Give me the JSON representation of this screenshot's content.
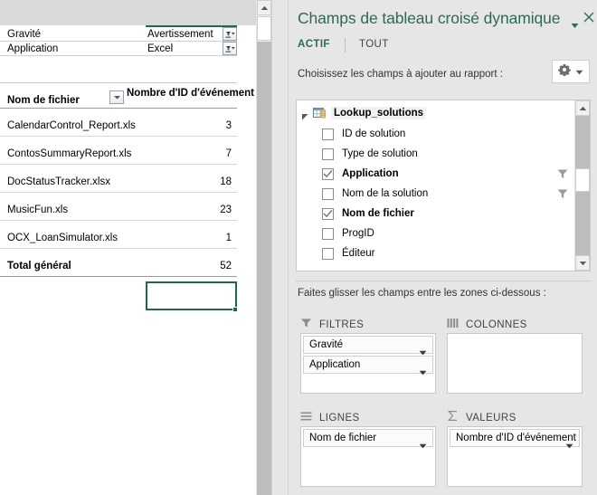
{
  "worksheet": {
    "pivot": {
      "report_filters": [
        {
          "label": "Gravité",
          "value": "Avertissement",
          "filter_icon": "filter-dropdown-icon"
        },
        {
          "label": "Application",
          "value": "Excel",
          "filter_icon": "filter-dropdown-icon"
        }
      ],
      "row_header": "Nom de fichier",
      "row_header_dropdown_icon": "chevron-down-icon",
      "value_header": "Nombre d'ID d'événement",
      "rows": [
        {
          "name": "CalendarControl_Report.xls",
          "value": "3"
        },
        {
          "name": "ContosSummaryReport.xls",
          "value": "7"
        },
        {
          "name": "DocStatusTracker.xlsx",
          "value": "18"
        },
        {
          "name": "MusicFun.xls",
          "value": "23"
        },
        {
          "name": "OCX_LoanSimulator.xls",
          "value": "1"
        }
      ],
      "total_row": {
        "name": "Total général",
        "value": "52"
      },
      "selected_cell_value": "52"
    },
    "scrollbar": {
      "up_arrow_icon": "triangle-up-icon"
    }
  },
  "fields_pane": {
    "title": "Champs de tableau croisé dynamique",
    "title_caret_icon": "chevron-down-icon",
    "close_icon": "close-icon",
    "tabs": [
      {
        "label": "ACTIF",
        "active": true
      },
      {
        "label": "TOUT",
        "active": false
      }
    ],
    "choose_fields_label": "Choisissez les champs à ajouter au rapport :",
    "tools_button": {
      "gear_icon": "gear-icon",
      "caret_icon": "chevron-down-icon"
    },
    "field_list": {
      "table_name": "Lookup_solutions",
      "table_icon": "table-icon",
      "expand_icon": "triangle-collapse-icon",
      "fields": [
        {
          "label": "ID de solution",
          "checked": false,
          "filtered": false
        },
        {
          "label": "Type de solution",
          "checked": false,
          "filtered": false
        },
        {
          "label": "Application",
          "checked": true,
          "filtered": true
        },
        {
          "label": "Nom de la solution",
          "checked": false,
          "filtered": true
        },
        {
          "label": "Nom de fichier",
          "checked": true,
          "filtered": false
        },
        {
          "label": "ProgID",
          "checked": false,
          "filtered": false
        },
        {
          "label": "Éditeur",
          "checked": false,
          "filtered": false
        }
      ],
      "scrollbar": {
        "up_arrow_icon": "triangle-up-icon",
        "down_arrow_icon": "triangle-down-icon"
      }
    },
    "drag_instruction": "Faites glisser les champs entre les zones ci-dessous :",
    "zones": [
      {
        "id": "filters",
        "title": "FILTRES",
        "icon": "funnel-icon",
        "chips": [
          {
            "label": "Gravité",
            "caret_icon": "chevron-down-icon"
          },
          {
            "label": "Application",
            "caret_icon": "chevron-down-icon"
          }
        ]
      },
      {
        "id": "columns",
        "title": "COLONNES",
        "icon": "columns-icon",
        "chips": []
      },
      {
        "id": "rows",
        "title": "LIGNES",
        "icon": "rows-icon",
        "chips": [
          {
            "label": "Nom de fichier",
            "caret_icon": "chevron-down-icon"
          }
        ]
      },
      {
        "id": "values",
        "title": "VALEURS",
        "icon": "sigma-icon",
        "chips": [
          {
            "label": "Nombre d'ID d'événement",
            "caret_icon": "chevron-down-icon"
          }
        ]
      }
    ]
  },
  "colors": {
    "accent_green": "#2e6b4f",
    "selection_green": "#1e6b43",
    "pane_background": "#e6e6e6",
    "sheet_background": "#ffffff",
    "scrollbar_track": "#bdbdbd"
  }
}
